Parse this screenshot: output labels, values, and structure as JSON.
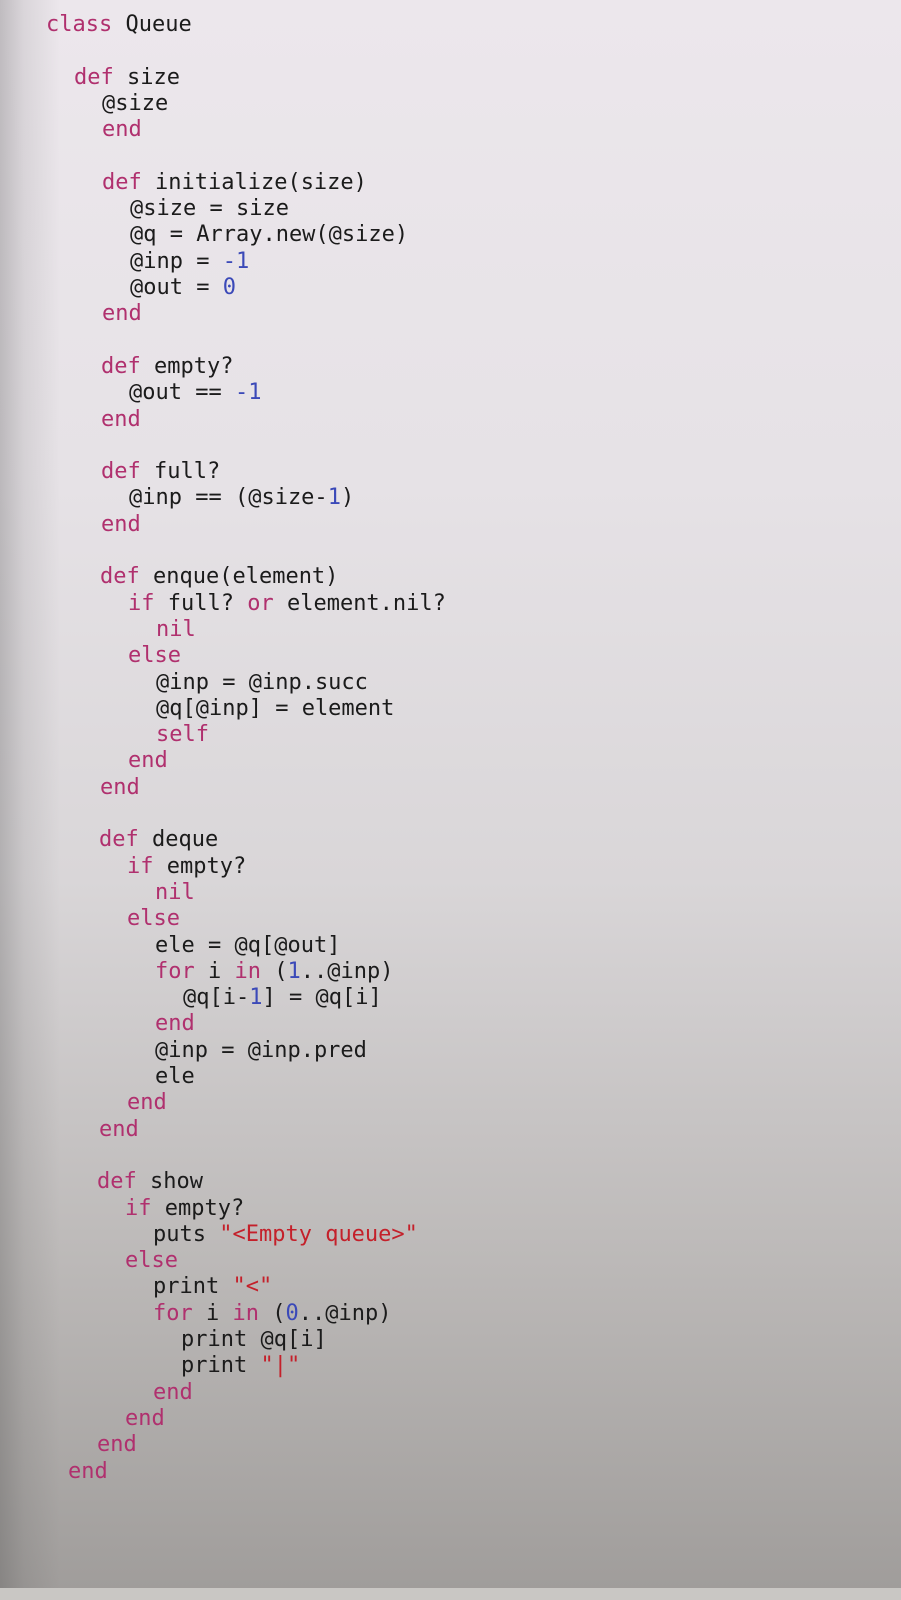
{
  "document": {
    "language": "ruby",
    "colors": {
      "keyword": "#b0306e",
      "number": "#3b49b8",
      "string": "#c4202a",
      "text": "#1b1b1b"
    },
    "lines": [
      [
        {
          "t": "kw",
          "v": "class"
        },
        {
          "t": "txt",
          "v": " Queue"
        }
      ],
      [],
      [
        {
          "t": "kw",
          "v": "def"
        },
        {
          "t": "txt",
          "v": " size"
        }
      ],
      [
        {
          "t": "txt",
          "v": "@size"
        }
      ],
      [
        {
          "t": "kw",
          "v": "end"
        }
      ],
      [],
      [
        {
          "t": "kw",
          "v": "def"
        },
        {
          "t": "txt",
          "v": " initialize(size)"
        }
      ],
      [
        {
          "t": "txt",
          "v": "@size = size"
        }
      ],
      [
        {
          "t": "txt",
          "v": "@q = Array.new(@size)"
        }
      ],
      [
        {
          "t": "txt",
          "v": "@inp = "
        },
        {
          "t": "num",
          "v": "-1"
        }
      ],
      [
        {
          "t": "txt",
          "v": "@out = "
        },
        {
          "t": "num",
          "v": "0"
        }
      ],
      [
        {
          "t": "kw",
          "v": "end"
        }
      ],
      [],
      [
        {
          "t": "kw",
          "v": "def"
        },
        {
          "t": "txt",
          "v": " empty?"
        }
      ],
      [
        {
          "t": "txt",
          "v": "@out == "
        },
        {
          "t": "num",
          "v": "-1"
        }
      ],
      [
        {
          "t": "kw",
          "v": "end"
        }
      ],
      [],
      [
        {
          "t": "kw",
          "v": "def"
        },
        {
          "t": "txt",
          "v": " full?"
        }
      ],
      [
        {
          "t": "txt",
          "v": "@inp == (@size-"
        },
        {
          "t": "num",
          "v": "1"
        },
        {
          "t": "txt",
          "v": ")"
        }
      ],
      [
        {
          "t": "kw",
          "v": "end"
        }
      ],
      [],
      [
        {
          "t": "kw",
          "v": "def"
        },
        {
          "t": "txt",
          "v": " enque(element)"
        }
      ],
      [
        {
          "t": "kw",
          "v": "if"
        },
        {
          "t": "txt",
          "v": " full? "
        },
        {
          "t": "kw",
          "v": "or"
        },
        {
          "t": "txt",
          "v": " element.nil?"
        }
      ],
      [
        {
          "t": "kw",
          "v": "nil"
        }
      ],
      [
        {
          "t": "kw",
          "v": "else"
        }
      ],
      [
        {
          "t": "txt",
          "v": "@inp = @inp.succ"
        }
      ],
      [
        {
          "t": "txt",
          "v": "@q[@inp] = element"
        }
      ],
      [
        {
          "t": "kw",
          "v": "self"
        }
      ],
      [
        {
          "t": "kw",
          "v": "end"
        }
      ],
      [
        {
          "t": "kw",
          "v": "end"
        }
      ],
      [],
      [
        {
          "t": "kw",
          "v": "def"
        },
        {
          "t": "txt",
          "v": " deque"
        }
      ],
      [
        {
          "t": "kw",
          "v": "if"
        },
        {
          "t": "txt",
          "v": " empty?"
        }
      ],
      [
        {
          "t": "kw",
          "v": "nil"
        }
      ],
      [
        {
          "t": "kw",
          "v": "else"
        }
      ],
      [
        {
          "t": "txt",
          "v": "ele = @q[@out]"
        }
      ],
      [
        {
          "t": "kw",
          "v": "for"
        },
        {
          "t": "txt",
          "v": " i "
        },
        {
          "t": "kw",
          "v": "in"
        },
        {
          "t": "txt",
          "v": " ("
        },
        {
          "t": "num",
          "v": "1"
        },
        {
          "t": "txt",
          "v": "..@inp)"
        }
      ],
      [
        {
          "t": "txt",
          "v": "@q[i-"
        },
        {
          "t": "num",
          "v": "1"
        },
        {
          "t": "txt",
          "v": "] = @q[i]"
        }
      ],
      [
        {
          "t": "kw",
          "v": "end"
        }
      ],
      [
        {
          "t": "txt",
          "v": "@inp = @inp.pred"
        }
      ],
      [
        {
          "t": "txt",
          "v": "ele"
        }
      ],
      [
        {
          "t": "kw",
          "v": "end"
        }
      ],
      [
        {
          "t": "kw",
          "v": "end"
        }
      ],
      [],
      [
        {
          "t": "kw",
          "v": "def"
        },
        {
          "t": "txt",
          "v": " show"
        }
      ],
      [
        {
          "t": "kw",
          "v": "if"
        },
        {
          "t": "txt",
          "v": " empty?"
        }
      ],
      [
        {
          "t": "txt",
          "v": "puts "
        },
        {
          "t": "str",
          "v": "\"<Empty queue>\""
        }
      ],
      [
        {
          "t": "kw",
          "v": "else"
        }
      ],
      [
        {
          "t": "txt",
          "v": "print "
        },
        {
          "t": "str",
          "v": "\"<\""
        }
      ],
      [
        {
          "t": "kw",
          "v": "for"
        },
        {
          "t": "txt",
          "v": " i "
        },
        {
          "t": "kw",
          "v": "in"
        },
        {
          "t": "txt",
          "v": " ("
        },
        {
          "t": "num",
          "v": "0"
        },
        {
          "t": "txt",
          "v": "..@inp)"
        }
      ],
      [
        {
          "t": "txt",
          "v": "print @q[i]"
        }
      ],
      [
        {
          "t": "txt",
          "v": "print "
        },
        {
          "t": "str",
          "v": "\"|\""
        }
      ],
      [
        {
          "t": "kw",
          "v": "end"
        }
      ],
      [
        {
          "t": "kw",
          "v": "end"
        }
      ],
      [
        {
          "t": "kw",
          "v": "end"
        }
      ],
      [
        {
          "t": "kw",
          "v": "end"
        }
      ]
    ]
  }
}
